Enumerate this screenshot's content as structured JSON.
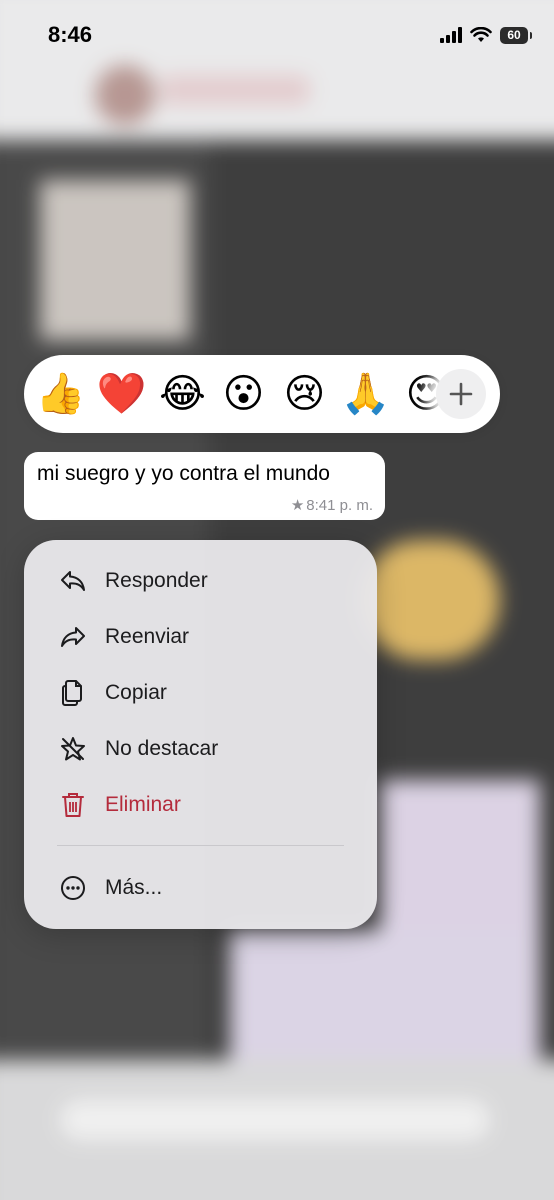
{
  "status_bar": {
    "time": "8:46",
    "battery": "60",
    "signal_icon": "signal-icon",
    "wifi_icon": "wifi-icon"
  },
  "reactions": {
    "emojis": [
      "👍",
      "❤️",
      "😂",
      "😮",
      "😢",
      "🙏",
      "😍"
    ],
    "more_icon": "plus-icon"
  },
  "message": {
    "text": "mi suegro y yo contra el mundo",
    "star": "★",
    "time": "8:41 p. m."
  },
  "menu": {
    "items": [
      {
        "label": "Responder",
        "icon": "reply-icon"
      },
      {
        "label": "Reenviar",
        "icon": "forward-icon"
      },
      {
        "label": "Copiar",
        "icon": "copy-icon"
      },
      {
        "label": "No destacar",
        "icon": "unstar-icon"
      },
      {
        "label": "Eliminar",
        "icon": "trash-icon"
      },
      {
        "label": "Más...",
        "icon": "more-icon"
      }
    ],
    "danger_color": "#b42b3c"
  }
}
